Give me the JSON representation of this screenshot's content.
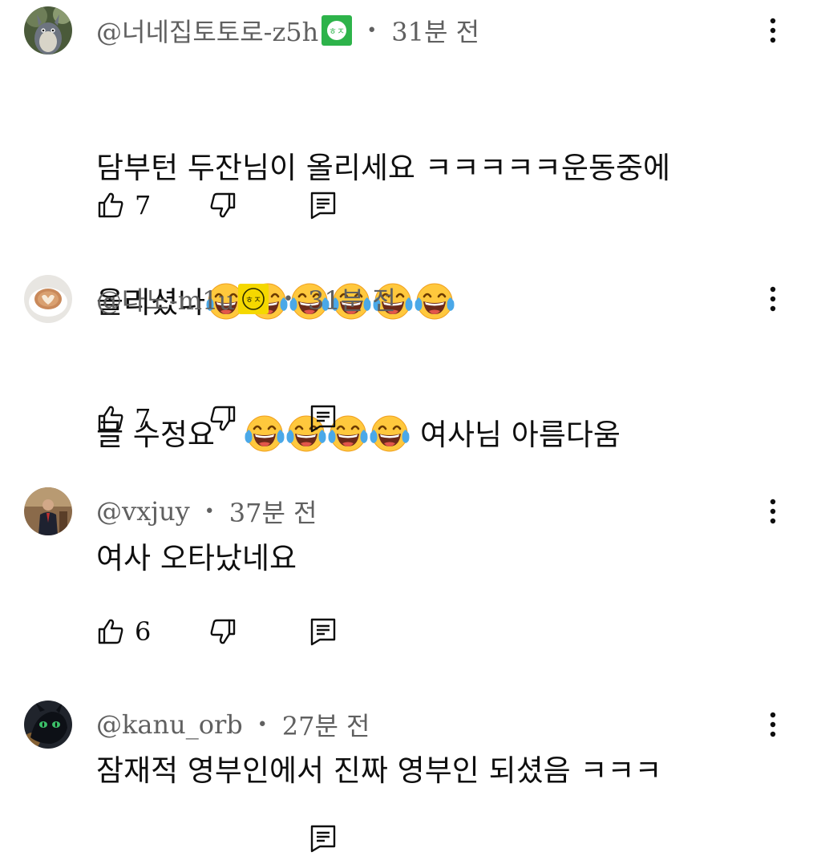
{
  "comments": [
    {
      "handle": "@너네집토토로-z5h",
      "badge": {
        "text": "ㅎㅈ",
        "color": "#2db34a"
      },
      "separator": "•",
      "time": "31분 전",
      "text_line1": "담부턴 두잔님이 올리세요 ㅋㅋㅋㅋㅋ운동중에",
      "text_line2": "올리셨나",
      "emoji_count_line2": 6,
      "likes": "7",
      "avatar": "totoro-avatar"
    },
    {
      "handle": "@나노-m1u",
      "badge": {
        "text": "ㅎㅈ",
        "color": "#f5d800"
      },
      "separator": "•",
      "time": "31분 전",
      "text_before_emoji": "글 수정요",
      "emoji_count": 4,
      "text_after_emoji": "여사님 아름다움",
      "likes": "7",
      "avatar": "latte-avatar"
    },
    {
      "handle": "@vxjuy",
      "separator": "•",
      "time": "37분 전",
      "text": "여사 오타났네요",
      "likes": "6",
      "avatar": "person-avatar"
    },
    {
      "handle": "@kanu_orb",
      "separator": "•",
      "time": "27분 전",
      "text": "잠재적 영부인에서 진짜 영부인 되셨음 ㅋㅋㅋ",
      "avatar": "dragon-avatar"
    }
  ],
  "colors": {
    "meta_text": "#606060",
    "body_text": "#0f0f0f",
    "emoji_face": "#ffc83d",
    "emoji_tear": "#4aa8e8"
  },
  "icons": [
    "thumbs-up-icon",
    "thumbs-down-icon",
    "reply-icon",
    "more-vert-icon",
    "laughing-tears-emoji"
  ]
}
